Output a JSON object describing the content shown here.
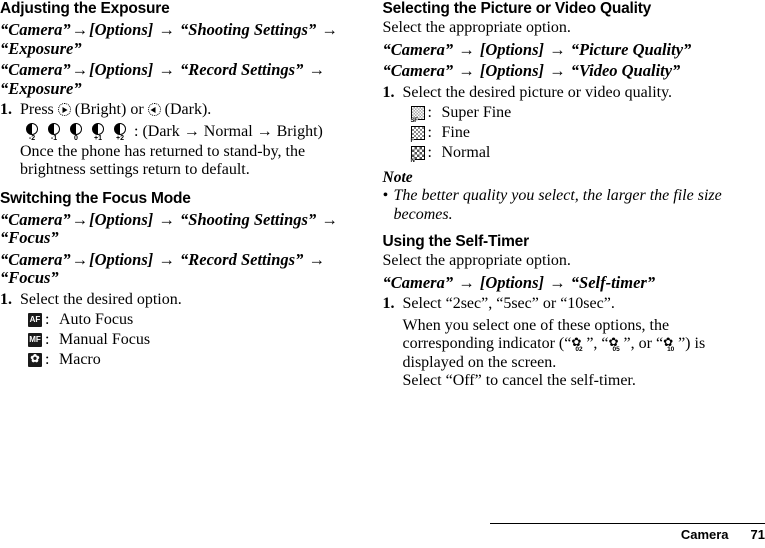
{
  "page": {
    "footer": {
      "section": "Camera",
      "page_number": "71"
    }
  },
  "left_column": {
    "section1": {
      "heading": "Adjusting the Exposure",
      "path1": {
        "p1": "“Camera”",
        "a1": "→",
        "p2": "[Options]",
        "a2": "→",
        "p3": "“Shooting Settings”",
        "a3": "→",
        "p4": "“Exposure”"
      },
      "path2": {
        "p1": "“Camera”",
        "a1": "→",
        "p2": "[Options]",
        "a2": "→",
        "p3": "“Record Settings”",
        "a3": "→",
        "p4": "“Exposure”"
      },
      "step1": {
        "num": "1.",
        "text_before": "Press",
        "text_mid": "(Bright) or",
        "text_after": "(Dark)."
      },
      "exposure_scale": {
        "labels": [
          "-2",
          "-1",
          "0",
          "+1",
          "+2"
        ],
        "trailing": ": (Dark → Normal → Bright)"
      },
      "note_line1": "Once the phone has returned to stand-by, the",
      "note_line2": "brightness settings return to default."
    },
    "section2": {
      "heading": "Switching the Focus Mode",
      "path1": {
        "p1": "“Camera”",
        "a1": "→",
        "p2": "[Options]",
        "a2": "→",
        "p3": "“Shooting Settings”",
        "a3": "→",
        "p4": "“Focus”"
      },
      "path2": {
        "p1": "“Camera”",
        "a1": "→",
        "p2": "[Options]",
        "a2": "→",
        "p3": "“Record Settings”",
        "a3": "→",
        "p4": "“Focus”"
      },
      "step1": {
        "num": "1.",
        "text": "Select the desired option."
      },
      "focus_options": [
        {
          "icon": "af-icon",
          "icon_text": "AF",
          "colon": ":",
          "label": "Auto Focus"
        },
        {
          "icon": "mf-icon",
          "icon_text": "MF",
          "colon": ":",
          "label": "Manual Focus"
        },
        {
          "icon": "macro-flower-icon",
          "icon_text": "✿",
          "colon": ":",
          "label": "Macro"
        }
      ]
    }
  },
  "right_column": {
    "section1": {
      "heading": "Selecting the Picture or Video Quality",
      "intro": "Select the appropriate option.",
      "path1": {
        "p1": "“Camera”",
        "a1": "→",
        "p2": "[Options]",
        "a2": "→",
        "p3": "“Picture Quality”"
      },
      "path2": {
        "p1": "“Camera”",
        "a1": "→",
        "p2": "[Options]",
        "a2": "→",
        "p3": "“Video Quality”"
      },
      "step1": {
        "num": "1.",
        "text": "Select the desired picture or video quality."
      },
      "quality_options": [
        {
          "icon": "quality-super-fine-icon",
          "tag": "SF",
          "colon": ":",
          "label": "Super Fine"
        },
        {
          "icon": "quality-fine-icon",
          "tag": "F",
          "colon": ":",
          "label": "Fine"
        },
        {
          "icon": "quality-normal-icon",
          "tag": "N",
          "colon": ":",
          "label": "Normal"
        }
      ],
      "note": {
        "heading": "Note",
        "bullet": "•",
        "text": "The better quality you select, the larger the file size becomes."
      }
    },
    "section2": {
      "heading": "Using the Self-Timer",
      "intro": "Select the appropriate option.",
      "path1": {
        "p1": "“Camera”",
        "a1": "→",
        "p2": "[Options]",
        "a2": "→",
        "p3": "“Self-timer”"
      },
      "step1": {
        "num": "1.",
        "text": "Select “2sec”, “5sec” or “10sec”."
      },
      "body": {
        "line1": "When you select one of these options, the",
        "line2_a": "corresponding indicator (“",
        "line2_b": "”, “",
        "line2_c": "”, or “",
        "line2_d": "”) is",
        "line3": "displayed on the screen.",
        "line4": "Select “Off” to cancel the self-timer.",
        "timer_subs": [
          "02",
          "05",
          "10"
        ],
        "timer_glyph": "✿"
      }
    }
  }
}
